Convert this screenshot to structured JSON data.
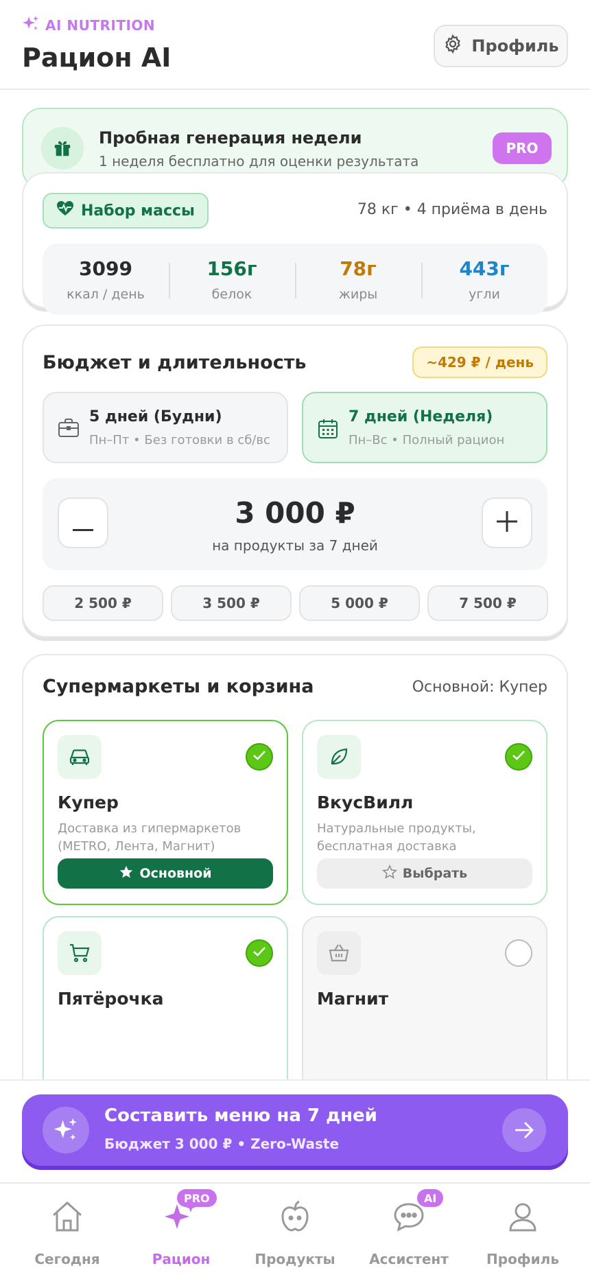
{
  "header": {
    "brand": "AI NUTRITION",
    "title": "Рацион AI",
    "profile_button": "Профиль"
  },
  "promo": {
    "title": "Пробная генерация недели",
    "subtitle": "1 неделя бесплатно для оценки результата",
    "badge": "PRO"
  },
  "goal": {
    "label": "Набор массы",
    "meta": "78 кг • 4 приёма в день",
    "stats": [
      {
        "value": "3099",
        "label": "ккал / день",
        "color": "#2b2b2b"
      },
      {
        "value": "156г",
        "label": "белок",
        "color": "#137148"
      },
      {
        "value": "78г",
        "label": "жиры",
        "color": "#c07a06"
      },
      {
        "value": "443г",
        "label": "угли",
        "color": "#1e86c8"
      }
    ]
  },
  "budget": {
    "title": "Бюджет и длительность",
    "per_day": "~429 ₽ / день",
    "durations": [
      {
        "title": "5 дней (Будни)",
        "subtitle": "Пн–Пт • Без готовки в сб/вс",
        "icon": "briefcase-icon",
        "selected": false
      },
      {
        "title": "7 дней (Неделя)",
        "subtitle": "Пн–Вс • Полный рацион",
        "icon": "calendar-icon",
        "selected": true
      }
    ],
    "amount": "3 000 ₽",
    "amount_sub": "на продукты за 7 дней",
    "presets": [
      "2 500 ₽",
      "3 500 ₽",
      "5 000 ₽",
      "7 500 ₽"
    ]
  },
  "stores": {
    "title": "Супермаркеты и корзина",
    "main_label": "Основной: Купер",
    "items": [
      {
        "name": "Купер",
        "desc": "Доставка из гипермаркетов (METRO, Лента, Магнит)",
        "button": "Основной",
        "checked": true,
        "icon": "car-icon"
      },
      {
        "name": "ВкусВилл",
        "desc": "Натуральные продукты, бесплатная доставка",
        "button": "Выбрать",
        "checked": true,
        "icon": "leaf-icon"
      },
      {
        "name": "Пятёрочка",
        "desc": "",
        "button": "",
        "checked": true,
        "icon": "cart-icon"
      },
      {
        "name": "Магнит",
        "desc": "",
        "button": "",
        "checked": false,
        "icon": "basket-icon"
      }
    ]
  },
  "cta": {
    "title": "Составить меню на 7 дней",
    "subtitle": "Бюджет 3 000 ₽ • Zero-Waste"
  },
  "nav": {
    "items": [
      {
        "label": "Сегодня",
        "icon": "home-icon",
        "active": false,
        "badge": ""
      },
      {
        "label": "Рацион",
        "icon": "sparkles-icon",
        "active": true,
        "badge": "PRO"
      },
      {
        "label": "Продукты",
        "icon": "apple-icon",
        "active": false,
        "badge": ""
      },
      {
        "label": "Ассистент",
        "icon": "chat-icon",
        "active": false,
        "badge": "AI"
      },
      {
        "label": "Профиль",
        "icon": "user-icon",
        "active": false,
        "badge": ""
      }
    ]
  },
  "colors": {
    "accent_purple": "#8e5bf0",
    "brand_pink": "#c878ef",
    "green_dark": "#137148",
    "green_check": "#5cc715"
  }
}
